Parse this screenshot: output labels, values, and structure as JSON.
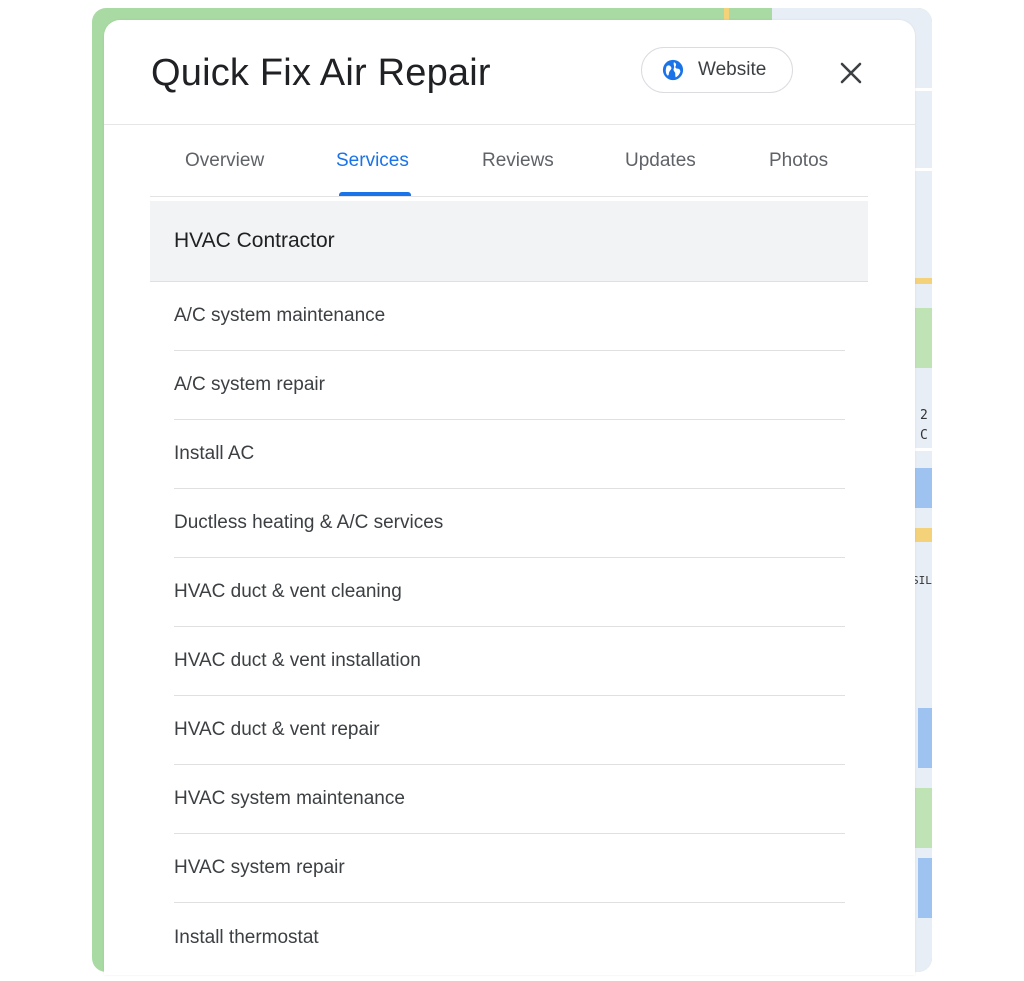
{
  "business": {
    "name": "Quick Fix Air Repair"
  },
  "header": {
    "website_label": "Website",
    "website_icon": "globe-icon",
    "close_icon": "close-icon"
  },
  "tabs": [
    {
      "label": "Overview",
      "active": false
    },
    {
      "label": "Services",
      "active": true
    },
    {
      "label": "Reviews",
      "active": false
    },
    {
      "label": "Updates",
      "active": false
    },
    {
      "label": "Photos",
      "active": false
    }
  ],
  "services_section": {
    "category": "HVAC Contractor",
    "items": [
      "A/C system maintenance",
      "A/C system repair",
      "Install AC",
      "Ductless heating & A/C services",
      "HVAC duct & vent cleaning",
      "HVAC duct & vent installation",
      "HVAC duct & vent repair",
      "HVAC system maintenance",
      "HVAC system repair",
      "Install thermostat"
    ]
  },
  "map_labels": [
    "2",
    "C",
    "SIL"
  ],
  "colors": {
    "accent": "#1a73e8",
    "map_green": "#aadaa3",
    "text_primary": "#202124",
    "text_secondary": "#5f6368"
  }
}
